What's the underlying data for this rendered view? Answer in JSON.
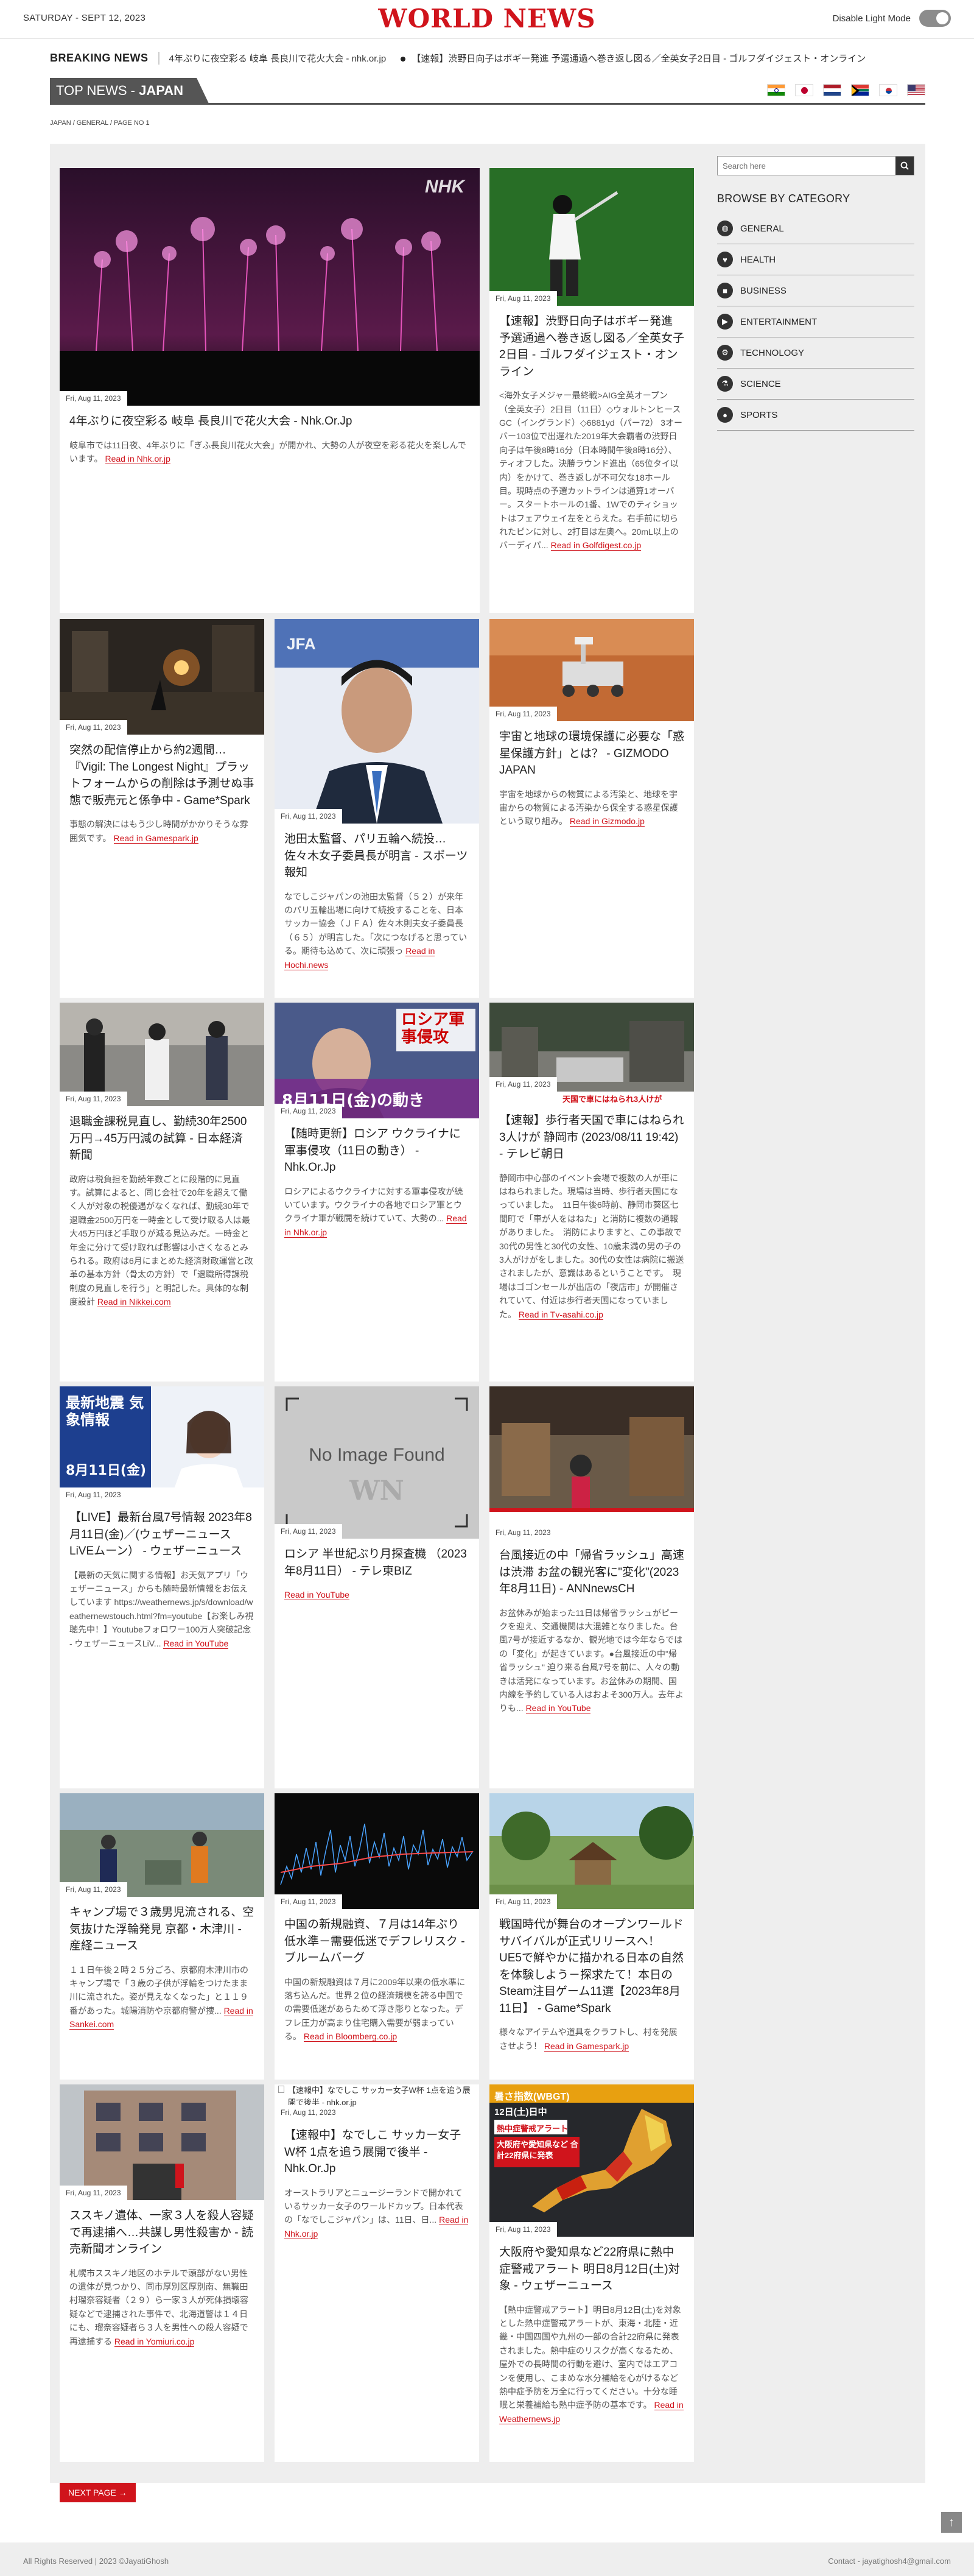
{
  "topbar": {
    "date": "SATURDAY - SEPT 12, 2023",
    "logo": "WORLD NEWS",
    "mode_label": "Disable Light Mode"
  },
  "breaking": {
    "label": "BREAKING NEWS",
    "items": [
      "4年ぶりに夜空彩る 岐阜 長良川で花火大会 - nhk.or.jp",
      "【速報】渋野日向子はボギー発進 予選通過へ巻き返し図る／全英女子2日目 - ゴルフダイジェスト・オンライン"
    ]
  },
  "section": {
    "prefix": "TOP NEWS - ",
    "country": "JAPAN"
  },
  "breadcrumb": "JAPAN / GENERAL / PAGE NO 1",
  "flags": [
    "india-flag",
    "japan-flag",
    "netherlands-flag",
    "south-africa-flag",
    "south-korea-flag",
    "usa-flag"
  ],
  "search": {
    "placeholder": "Search here"
  },
  "sidebar": {
    "title": "BROWSE BY CATEGORY",
    "categories": [
      "GENERAL",
      "HEALTH",
      "BUSINESS",
      "ENTERTAINMENT",
      "TECHNOLOGY",
      "SCIENCE",
      "SPORTS"
    ]
  },
  "read_prefix": "Read in ",
  "articles": [
    {
      "date": "Fri, Aug 11, 2023",
      "title": "4年ぶりに夜空彩る 岐阜 長良川で花火大会 - Nhk.Or.Jp",
      "desc": "岐阜市では11日夜、4年ぶりに「ぎふ長良川花火大会」が開かれ、大勢の人が夜空を彩る花火を楽しんでいます。",
      "source": "Nhk.or.jp",
      "image": "fireworks-photo"
    },
    {
      "date": "Fri, Aug 11, 2023",
      "title": "【速報】渋野日向子はボギー発進 予選通過へ巻き返し図る／全英女子2日目 - ゴルフダイジェスト・オンライン",
      "desc": "<海外女子メジャー最終戦>AIG全英オープン（全英女子）2日目（11日）◇ウォルトンヒースGC（イングランド）◇6881yd（パー72） 3オーバー103位で出遅れた2019年大会覇者の渋野日向子は午後8時16分（日本時間午後8時16分）、ティオフした。決勝ラウンド進出（65位タイ以内）をかけて、巻き返しが不可欠な18ホール目。現時点の予選カットラインは通算1オーバー。スタートホールの1番、1Wでのティショットはフェアウェイ左をとらえた。右手前に切られたピンに対し、2打目は左奥へ。20mL以上のバーディパ...",
      "source": "Golfdigest.co.jp",
      "image": "golfer-photo"
    },
    {
      "date": "Fri, Aug 11, 2023",
      "title": "突然の配信停止から約2週間…『Vigil: The Longest Night』プラットフォームからの削除は予測せぬ事態で販売元と係争中 - Game*Spark",
      "desc": "事態の解決にはもう少し時間がかかりそうな雰囲気です。",
      "source": "Gamespark.jp",
      "image": "game-screenshot"
    },
    {
      "date": "Fri, Aug 11, 2023",
      "title": "池田太監督、パリ五輪へ続投… 佐々木女子委員長が明言 - スポーツ報知",
      "desc": "なでしこジャパンの池田太監督（５２）が来年のパリ五輪出場に向けて続投することを、日本サッカー協会（ＪＦＡ）佐々木則夫女子委員長（６５）が明言した。「次につなげると思っている。期待も込めて、次に頑張っ",
      "source": "Hochi.news",
      "image": "coach-portrait"
    },
    {
      "date": "Fri, Aug 11, 2023",
      "title": "宇宙と地球の環境保護に必要な「惑星保護方針」とは？ - GIZMODO JAPAN",
      "desc": "宇宙を地球からの物質による汚染と、地球を宇宙からの物質による汚染から保全する惑星保護という取り組み。",
      "source": "Gizmodo.jp",
      "image": "mars-rover-photo"
    },
    {
      "date": "Fri, Aug 11, 2023",
      "title": "退職金課税見直し、勤続30年2500万円→45万円減の試算 - 日本経済新聞",
      "desc": "政府は税負担を勤続年数ごとに段階的に見直す。試算によると、同じ会社で20年を超えて働く人が対象の税優遇がなくなれば、勤続30年で退職金2500万円を一時金として受け取る人は最大45万円ほど手取りが減る見込みだ。一時金と年金に分けて受け取れば影響は小さくなるとみられる。政府は6月にまとめた経済財政運営と改革の基本方針（骨太の方針）で「退職所得課税制度の見直しを行う」と明記した。具体的な制度設計",
      "source": "Nikkei.com",
      "image": "commuters-photo"
    },
    {
      "date": "Fri, Aug 11, 2023",
      "title": "【随時更新】ロシア ウクライナに軍事侵攻（11日の動き） - Nhk.Or.Jp",
      "desc": "ロシアによるウクライナに対する軍事侵攻が続いています。ウクライナの各地でロシア軍とウクライナ軍が戦闘を続けていて、大勢の...",
      "source": "Nhk.or.jp",
      "image": "putin-broadcast",
      "overlay_top": "ロシア軍事侵攻",
      "overlay_bottom": "8月11日(金)の動き"
    },
    {
      "date": "Fri, Aug 11, 2023",
      "title": "【速報】歩行者天国で車にはねられ3人けが 静岡市 (2023/08/11 19:42) - テレビ朝日",
      "desc": "静岡市中心部のイベント会場で複数の人が車にはねられました。現場は当時、歩行者天国になっていました。　11日午後6時前、静岡市葵区七間町で「車が人をはねた」と消防に複数の通報がありました。　消防によりますと、この事故で30代の男性と30代の女性、10歳未満の男の子の3人がけがをしました。30代の女性は病院に搬送されましたが、意識はあるということです。　現場はゴゴンセールが出店の「夜店市」が開催されていて、付近は歩行者天国になっていました。",
      "source": "Tv-asahi.co.jp",
      "image": "street-scene",
      "overlay_bottom": "天国で車にはねられ3人けが"
    },
    {
      "date": "Fri, Aug 11, 2023",
      "title": "【LIVE】最新台風7号情報 2023年8月11日(金)／(ウェザーニュースLiVEムーン） - ウェザーニュース",
      "desc": "【最新の天気に関する情報】お天気アプリ「ウェザーニュース」からも随時最新情報をお伝えしています https://weathernews.jp/s/download/weathernewstouch.html?fm=youtube【お楽しみ視聴先中！】Youtubeフォロワー100万人突破記念 - ウェザーニュースLiV...",
      "source": "YouTube",
      "image": "weather-broadcast",
      "overlay_top": "最新地震 気象情報",
      "overlay_bottom": "8月11日(金)"
    },
    {
      "date": "Fri, Aug 11, 2023",
      "title": "ロシア 半世紀ぶり月探査機 （2023年8月11日） - テレ東BIZ",
      "desc": "",
      "source": "YouTube",
      "image": "no-image-placeholder",
      "placeholder_text": "No Image Found",
      "placeholder_mark": "WN"
    },
    {
      "date": "Fri, Aug 11, 2023",
      "title": "台風接近の中「帰省ラッシュ」高速は渋滞 お盆の観光客に\"変化\"(2023年8月11日) - ANNnewsCH",
      "desc": "お盆休みが始まった11日は帰省ラッシュがピークを迎え、交通機関は大混雑となりました。台風7号が接近するなか、観光地では今年ならではの「変化」が起きています。●台風接近の中\"帰省ラッシュ\" 迫り来る台風7号を前に、人々の動きは活発になっています。お盆休みの期間、国内線を予約している人はおよそ300万人。去年よりも...",
      "source": "YouTube",
      "image": "travel-broadcast"
    },
    {
      "date": "Fri, Aug 11, 2023",
      "title": "キャンプ場で３歳男児流される、空気抜けた浮輪発見 京都・木津川 - 産経ニュース",
      "desc": "１１日午後２時２５分ごろ、京都府木津川市のキャンプ場で「３歳の子供が浮輪をつけたまま川に流された。姿が見えなくなった」と１１９番があった。城陽消防や京都府警が捜...",
      "source": "Sankei.com",
      "image": "rescue-photo"
    },
    {
      "date": "Fri, Aug 11, 2023",
      "title": "中国の新規融資、７月は14年ぶり低水準－需要低迷でデフレリスク - ブルームバーグ",
      "desc": "中国の新規融資は７月に2009年以来の低水準に落ち込んだ。世界２位の経済規模を誇る中国での需要低迷があらためて浮き彫りとなった。デフレ圧力が高まり住宅購入需要が弱まっている。",
      "source": "Bloomberg.co.jp",
      "image": "finance-chart"
    },
    {
      "date": "Fri, Aug 11, 2023",
      "title": "戦国時代が舞台のオープンワールドサバイバルが正式リリースへ！ UE5で鮮やかに描かれる日本の自然を体験しよう－探求たて！本日のSteam注目ゲーム11選【2023年8月11日】 - Game*Spark",
      "desc": "様々なアイテムや道具をクラフトし、村を発展させよう！",
      "source": "Gamespark.jp",
      "image": "village-screenshot"
    },
    {
      "date": "Fri, Aug 11, 2023",
      "title": "ススキノ遺体、一家３人を殺人容疑で再逮捕へ…共謀し男性殺害か - 読売新聞オンライン",
      "desc": "札幌市ススキノ地区のホテルで頭部がない男性の遺体が見つかり、同市厚別区厚別南、無職田村瑠奈容疑者（２９）ら一家３人が死体損壊容疑などで逮捕された事件で、北海道警は１４日にも、瑠奈容疑者ら３人を男性への殺人容疑で再逮捕する",
      "source": "Yomiuri.co.jp",
      "image": "building-photo"
    },
    {
      "date": "Fri, Aug 11, 2023",
      "title": "【速報中】なでしこ サッカー女子W杯 1点を追う展開で後半 - Nhk.Or.Jp",
      "desc": "オーストラリアとニュージーランドで開かれているサッカー女子のワールドカップ。日本代表の「なでしこジャパン」は、11日、日...",
      "source": "Nhk.or.jp",
      "image": "broken-image",
      "broken_alt": "【速報中】なでしこ サッカー女子W杯 1点を追う展開で後半 - nhk.or.jp"
    },
    {
      "date": "Fri, Aug 11, 2023",
      "title": "大阪府や愛知県など22府県に熱中症警戒アラート 明日8月12日(土)対象 - ウェザーニュース",
      "desc": "【熱中症警戒アラート】明日8月12日(土)を対象とした熱中症警戒アラートが、東海・北陸・近畿・中国四国や九州の一部の合計22府県に発表されました。熱中症のリスクが高くなるため、屋外での長時間の行動を避け、室内ではエアコンを使用し、こまめな水分補給を心がけるなど熱中症予防を万全に行ってください。十分な睡眠と栄養補給も熱中症予防の基本です。",
      "source": "Weathernews.jp",
      "image": "heat-map",
      "overlay_top": "暑さ指数(WBGT)",
      "overlay_sub": "12日(土)日中",
      "overlay_box1": "熱中症警戒アラート",
      "overlay_box2": "大阪府や愛知県など 合計22府県に発表"
    }
  ],
  "next_page": "NEXT PAGE →",
  "to_top": "↑",
  "footer": {
    "left": "All Rights Reserved | 2023 ©JayatiGhosh",
    "right": "Contact - jayatighosh4@gmail.com"
  },
  "colors": {
    "accent": "#d0141c",
    "panel": "#eeeeee",
    "dark": "#555555"
  }
}
